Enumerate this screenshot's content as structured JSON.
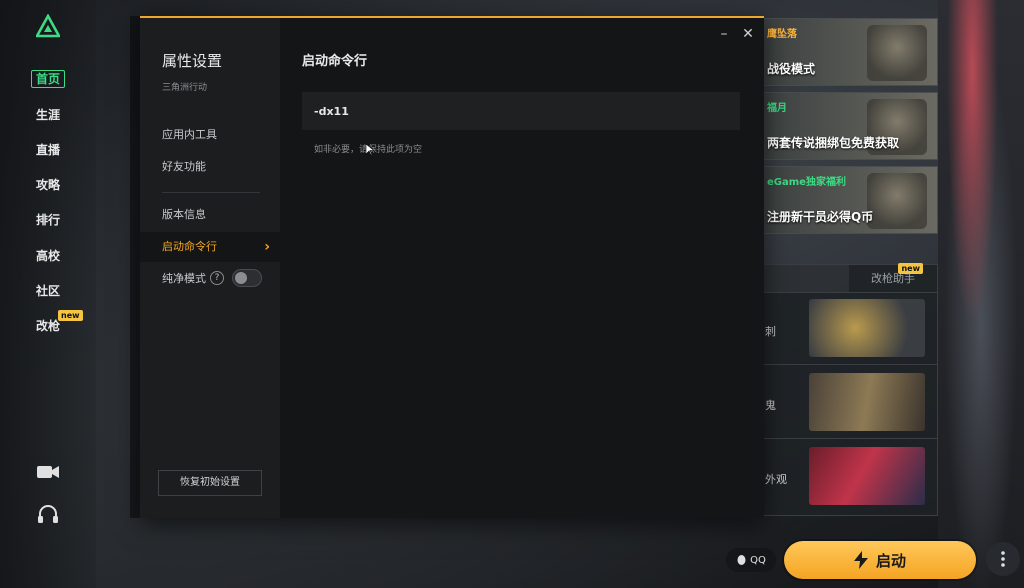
{
  "nav": {
    "items": [
      {
        "label": "首页",
        "active": true
      },
      {
        "label": "生涯"
      },
      {
        "label": "直播"
      },
      {
        "label": "攻略"
      },
      {
        "label": "排行"
      },
      {
        "label": "高校"
      },
      {
        "label": "社区"
      },
      {
        "label": "改枪",
        "badge": "new"
      }
    ],
    "icons": [
      "video-camera-icon",
      "headset-icon"
    ]
  },
  "promo": {
    "cards": [
      {
        "tag": "鹰坠落",
        "title": "战役模式"
      },
      {
        "tag": "福月",
        "title": "两套传说捆绑包免费获取"
      },
      {
        "tag": "eGame独家福利",
        "title": "注册新干员必得Q币"
      }
    ],
    "mod_panel": {
      "tab_left": "",
      "tab_right": "改枪助手",
      "tab_badge": "new",
      "row_suffixes": [
        "刺",
        "鬼",
        "外观"
      ]
    }
  },
  "bottom": {
    "qq_label": "QQ",
    "launch_label": "启动"
  },
  "dialog": {
    "title": "属性设置",
    "subtitle": "三角洲行动",
    "menu": [
      {
        "label": "应用内工具"
      },
      {
        "label": "好友功能"
      },
      {
        "label": "版本信息"
      },
      {
        "label": "启动命令行",
        "active": true
      },
      {
        "label": "纯净模式"
      }
    ],
    "pure_mode_help": "?",
    "pure_mode_enabled": false,
    "reset_label": "恢复初始设置",
    "main_title": "启动命令行",
    "command_value": "-dx11",
    "hint": "如非必要，请保持此项为空",
    "minimize_glyph": "–",
    "close_glyph": "✕"
  },
  "colors": {
    "accent": "#f5a623",
    "nav_active": "#3ddc84",
    "launch": "#f4a423"
  }
}
